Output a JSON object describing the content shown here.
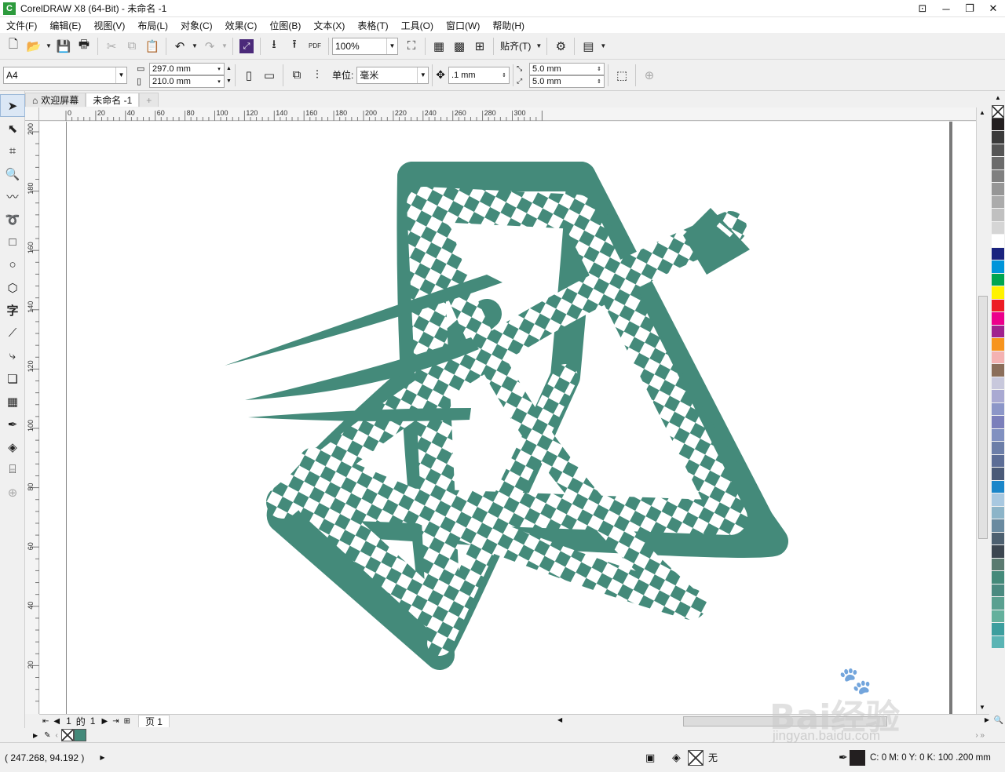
{
  "window": {
    "title": "CorelDRAW X8 (64-Bit) - 未命名 -1",
    "logo_letter": "C"
  },
  "menu": [
    "文件(F)",
    "编辑(E)",
    "视图(V)",
    "布局(L)",
    "对象(C)",
    "效果(C)",
    "位图(B)",
    "文本(X)",
    "表格(T)",
    "工具(O)",
    "窗口(W)",
    "帮助(H)"
  ],
  "toolbar": {
    "zoom": "100%",
    "snap_label": "贴齐(T)",
    "pdf_label": "PDF"
  },
  "property_bar": {
    "page_size": "A4",
    "width": "297.0 mm",
    "height": "210.0 mm",
    "units_label": "单位:",
    "units": "毫米",
    "nudge": ".1 mm",
    "dup_x": "5.0 mm",
    "dup_y": "5.0 mm"
  },
  "tabs": {
    "welcome": "欢迎屏幕",
    "document": "未命名 -1"
  },
  "ruler": {
    "h_ticks": [
      "0",
      "20",
      "40",
      "60",
      "80",
      "100",
      "120",
      "140",
      "160",
      "180",
      "200",
      "220",
      "240",
      "260",
      "280",
      "300"
    ],
    "v_ticks": [
      "200",
      "180",
      "160",
      "140",
      "120",
      "100",
      "80",
      "60",
      "40",
      "20"
    ]
  },
  "page_nav": {
    "current": "1",
    "of_label": "的",
    "total": "1",
    "page_tab": "页 1"
  },
  "status": {
    "coords": "( 247.268, 94.192 )",
    "fill_none": "无",
    "outline_info": "C: 0 M: 0 Y: 0 K: 100  .200 mm"
  },
  "watermark": {
    "brand": "Bai经验",
    "url": "jingyan.baidu.com"
  },
  "colors": {
    "shape_fill": "#448a7a",
    "accent": "#2d9b3d"
  },
  "palette": [
    "none",
    "#231f20",
    "#3a3a3a",
    "#555",
    "#6b6b6b",
    "#808080",
    "#969696",
    "#ababab",
    "#c0c0c0",
    "#d5d5d5",
    "#ffffff",
    "#1a237e",
    "#0095da",
    "#00a650",
    "#fff200",
    "#ed1c24",
    "#ec008c",
    "#a0228e",
    "#f7941d",
    "#f4b2b2",
    "#8b6e5a",
    "#c8c8dc",
    "#a9a9d2",
    "#8c96c8",
    "#7b7fbb",
    "#8090c0",
    "#6c7ea8",
    "#5c6d96",
    "#4a5a78",
    "#1b86c9",
    "#a8c8e0",
    "#8cb4c8",
    "#6a8aa0",
    "#4d6070",
    "#3c4650",
    "#5a7a70",
    "#448a7a",
    "#4a8a80",
    "#5aa090",
    "#64b09c",
    "#3c9e9e",
    "#5ab4b4"
  ]
}
